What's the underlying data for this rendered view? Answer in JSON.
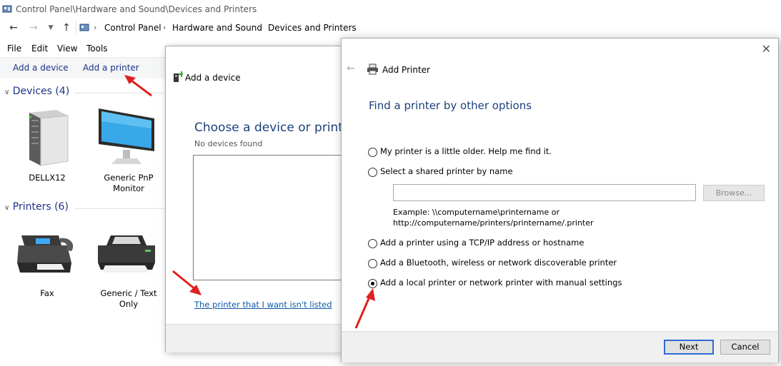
{
  "explorer": {
    "title": "Control Panel\\Hardware and Sound\\Devices and Printers",
    "breadcrumbs": [
      "Control Panel",
      "Hardware and Sound",
      "Devices and Printers"
    ],
    "menu": [
      "File",
      "Edit",
      "View",
      "Tools"
    ],
    "commands": [
      "Add a device",
      "Add a printer"
    ],
    "devices_header": "Devices (4)",
    "printers_header": "Printers (6)",
    "devices": [
      {
        "label": "DELLX12",
        "icon": "server-tower-icon"
      },
      {
        "label": "Generic PnP Monitor",
        "icon": "monitor-icon"
      }
    ],
    "printers": [
      {
        "label": "Fax",
        "icon": "fax-icon"
      },
      {
        "label": "Generic / Text Only",
        "icon": "printer-icon"
      }
    ]
  },
  "add_device": {
    "title": "Add a device",
    "heading": "Choose a device or printer",
    "status": "No devices found",
    "link": "The printer that I want isn't listed"
  },
  "add_printer": {
    "title": "Add Printer",
    "heading": "Find a printer by other options",
    "options": [
      {
        "label": "My printer is a little older. Help me find it.",
        "selected": false
      },
      {
        "label": "Select a shared printer by name",
        "selected": false
      },
      {
        "label": "Add a printer using a TCP/IP address or hostname",
        "selected": false
      },
      {
        "label": "Add a Bluetooth, wireless or network discoverable printer",
        "selected": false
      },
      {
        "label": "Add a local printer or network printer with manual settings",
        "selected": true
      }
    ],
    "shared_input_value": "",
    "browse_label": "Browse...",
    "example_line1": "Example: \\\\computername\\printername or",
    "example_line2": "http://computername/printers/printername/.printer",
    "next_label": "Next",
    "cancel_label": "Cancel"
  },
  "colors": {
    "accent_link": "#1e3287",
    "heading_blue": "#1e3f7a",
    "annotation_arrow": "#e02020"
  }
}
